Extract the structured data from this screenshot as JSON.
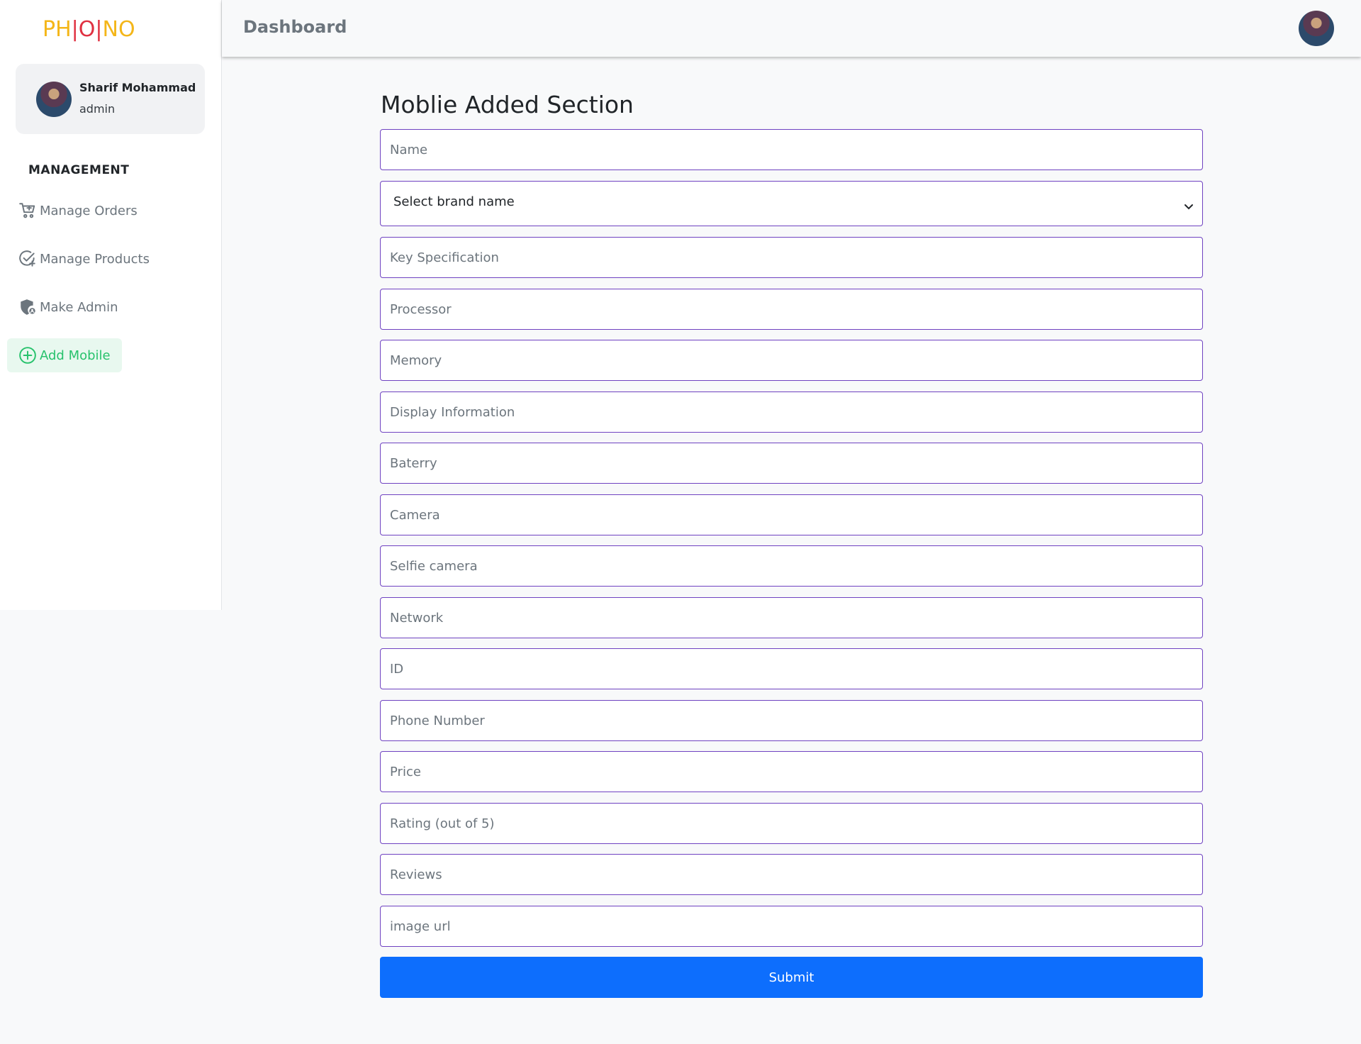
{
  "brand": {
    "part1": "PH",
    "sep1": "|",
    "part2": "O",
    "sep2": "|",
    "part3": "NO"
  },
  "profile": {
    "name": "Sharif Mohammad",
    "role": "admin"
  },
  "sidebar": {
    "section_title": "MANAGEMENT",
    "items": [
      {
        "label": "Manage Orders",
        "icon": "cart-icon"
      },
      {
        "label": "Manage Products",
        "icon": "check-plus-icon"
      },
      {
        "label": "Make Admin",
        "icon": "shield-user-icon"
      },
      {
        "label": "Add Mobile",
        "icon": "plus-circle-icon",
        "active": true
      }
    ]
  },
  "header": {
    "title": "Dashboard"
  },
  "form": {
    "title": "Moblie Added Section",
    "name_placeholder": "Name",
    "brand_select": "Select brand name",
    "fields": [
      "Key Specification",
      "Processor",
      "Memory",
      "Display Information",
      "Baterry",
      "Camera",
      "Selfie camera",
      "Network",
      "ID",
      "Phone Number",
      "Price",
      "Rating (out of 5)",
      "Reviews",
      "image url"
    ],
    "submit_label": "Submit"
  },
  "colors": {
    "accent": "#0d6efd",
    "field_border": "#6f42c1",
    "active_nav": "#27c26c",
    "logo_yellow": "#f4b619",
    "logo_red": "#e03141"
  }
}
